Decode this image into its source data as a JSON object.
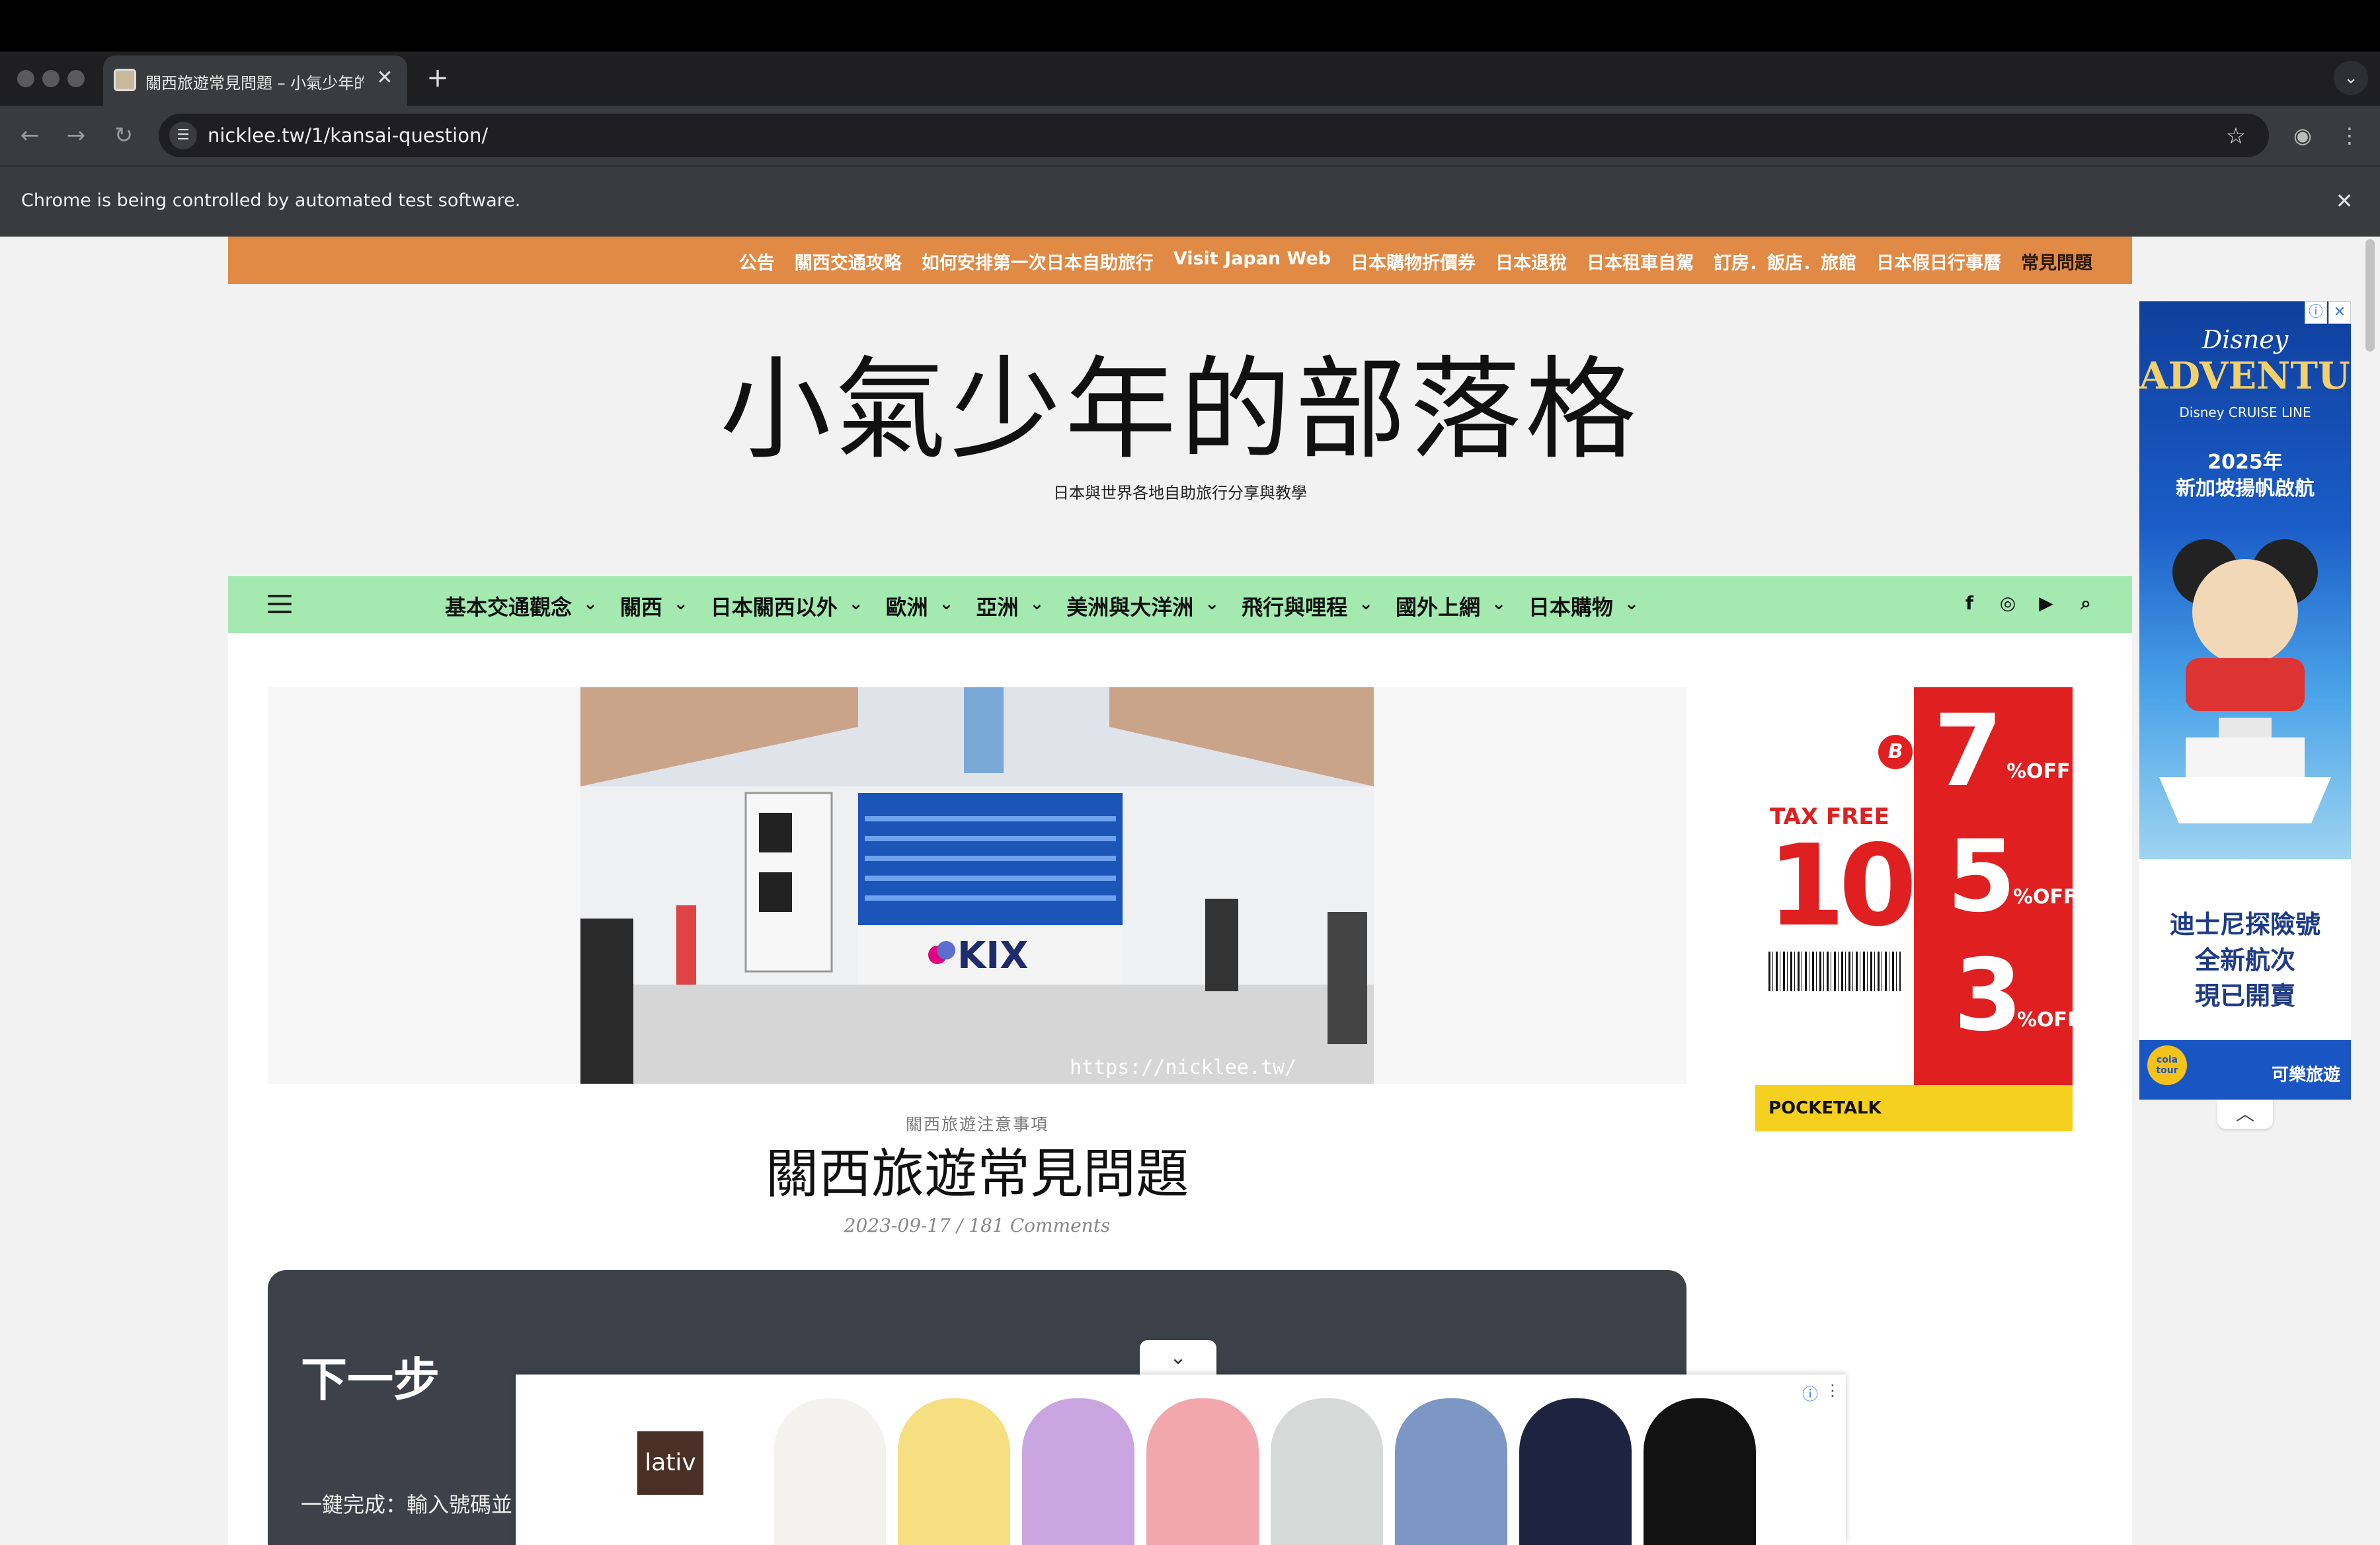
{
  "browser": {
    "tab_title": "關西旅遊常見問題 – 小氣少年的部落格",
    "tab_close": "✕",
    "new_tab": "+",
    "url": "nicklee.tw/1/kansai-question/",
    "automation_notice": "Chrome is being controlled by automated test software.",
    "infobar_close": "✕"
  },
  "topnav": {
    "items": [
      "公告",
      "關西交通攻略",
      "如何安排第一次日本自助旅行",
      "Visit Japan Web",
      "日本購物折價券",
      "日本退稅",
      "日本租車自駕",
      "訂房．飯店．旅館",
      "日本假日行事曆",
      "常見問題"
    ]
  },
  "header": {
    "site_title": "小氣少年的部落格",
    "tagline": "日本與世界各地自助旅行分享與教學"
  },
  "mainnav": {
    "items": [
      "基本交通觀念",
      "關西",
      "日本關西以外",
      "歐洲",
      "亞洲",
      "美洲與大洋洲",
      "飛行與哩程",
      "國外上網",
      "日本購物"
    ],
    "social": [
      "f",
      "◎",
      "▶"
    ],
    "search_icon": "⌕"
  },
  "article": {
    "hero_sign": "KIX",
    "hero_watermark": "https://nicklee.tw/",
    "category": "關西旅遊注意事項",
    "title": "關西旅遊常見問題",
    "date": "2023-09-17",
    "comments": "181 Comments",
    "meta_sep": "/"
  },
  "nextstep": {
    "title": "下一步",
    "text": "一鍵完成：輸入號碼並"
  },
  "ads": {
    "bic": {
      "tax_free": "TAX FREE",
      "ten": "10%",
      "seven": "7",
      "five": "5",
      "three": "3",
      "off": "%OFF",
      "logo": "B",
      "pocketalk": "POCKETALK"
    },
    "disney": {
      "title1": "Disney",
      "title2": "ADVENTURE",
      "sub": "Disney CRUISE LINE",
      "year": "2025年",
      "line": "新加坡揚帆啟航",
      "body": [
        "迪士尼探險號",
        "全新航次",
        "現已開賣"
      ],
      "brand": "可樂旅遊",
      "colatour": "cola tour"
    },
    "lativ": "lativ",
    "hoodie_colors": [
      "#f4f2ee",
      "#f5df80",
      "#c9a6e0",
      "#f1a7ac",
      "#d7d8d8",
      "#7d97c4",
      "#1d2340",
      "#121212"
    ]
  },
  "colors": {
    "topnav_bg": "#e08a45",
    "mainnav_bg": "#a3e9b0",
    "nextstep_bg": "#3d4149"
  }
}
